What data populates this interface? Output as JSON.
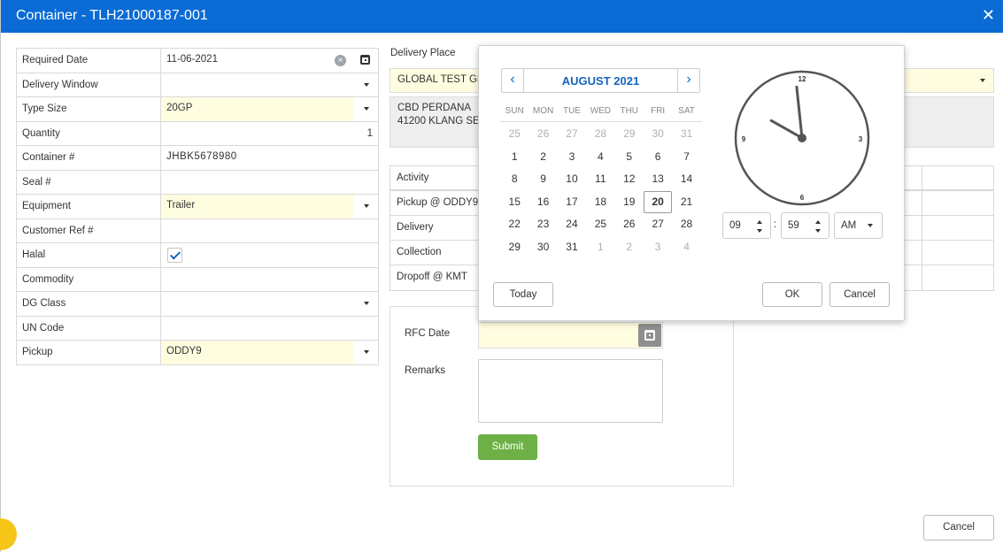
{
  "window": {
    "title": "Container - TLH21000187-001",
    "close_glyph": "✕"
  },
  "form": {
    "rows": [
      {
        "label": "Required Date",
        "value": "11-06-2021"
      },
      {
        "label": "Delivery Window",
        "value": ""
      },
      {
        "label": "Type Size",
        "value": "20GP"
      },
      {
        "label": "Quantity",
        "value": "1"
      },
      {
        "label": "Container #",
        "value": "JHBK5678980"
      },
      {
        "label": "Seal #",
        "value": ""
      },
      {
        "label": "Equipment",
        "value": "Trailer"
      },
      {
        "label": "Customer Ref #",
        "value": ""
      },
      {
        "label": "Halal",
        "checked": true
      },
      {
        "label": "Commodity",
        "value": ""
      },
      {
        "label": "DG Class",
        "value": ""
      },
      {
        "label": "UN Code",
        "value": ""
      },
      {
        "label": "Pickup",
        "value": "ODDY9"
      }
    ]
  },
  "delivery_place": {
    "label": "Delivery Place",
    "value": "GLOBAL TEST GR",
    "address_line1": "CBD PERDANA",
    "address_line2": "41200 KLANG SE"
  },
  "activity": {
    "header": "Activity",
    "rows": [
      "Pickup @ ODDY9",
      "Delivery",
      "Collection",
      "Dropoff @ KMT"
    ]
  },
  "rfc": {
    "date_label": "RFC Date",
    "date_value": "",
    "remarks_label": "Remarks",
    "remarks_value": "",
    "submit_label": "Submit"
  },
  "picker": {
    "month_title": "AUGUST 2021",
    "prev_glyph": "‹",
    "next_glyph": "›",
    "weekdays": [
      "SUN",
      "MON",
      "TUE",
      "WED",
      "THU",
      "FRI",
      "SAT"
    ],
    "days": [
      {
        "d": "25",
        "o": true
      },
      {
        "d": "26",
        "o": true
      },
      {
        "d": "27",
        "o": true
      },
      {
        "d": "28",
        "o": true
      },
      {
        "d": "29",
        "o": true
      },
      {
        "d": "30",
        "o": true
      },
      {
        "d": "31",
        "o": true
      },
      {
        "d": "1"
      },
      {
        "d": "2"
      },
      {
        "d": "3"
      },
      {
        "d": "4"
      },
      {
        "d": "5"
      },
      {
        "d": "6"
      },
      {
        "d": "7"
      },
      {
        "d": "8"
      },
      {
        "d": "9"
      },
      {
        "d": "10"
      },
      {
        "d": "11"
      },
      {
        "d": "12"
      },
      {
        "d": "13"
      },
      {
        "d": "14"
      },
      {
        "d": "15"
      },
      {
        "d": "16"
      },
      {
        "d": "17"
      },
      {
        "d": "18"
      },
      {
        "d": "19"
      },
      {
        "d": "20",
        "s": true
      },
      {
        "d": "21"
      },
      {
        "d": "22"
      },
      {
        "d": "23"
      },
      {
        "d": "24"
      },
      {
        "d": "25"
      },
      {
        "d": "26"
      },
      {
        "d": "27"
      },
      {
        "d": "28"
      },
      {
        "d": "29"
      },
      {
        "d": "30"
      },
      {
        "d": "31"
      },
      {
        "d": "1",
        "o": true
      },
      {
        "d": "2",
        "o": true
      },
      {
        "d": "3",
        "o": true
      },
      {
        "d": "4",
        "o": true
      }
    ],
    "today_label": "Today",
    "ok_label": "OK",
    "cancel_label": "Cancel",
    "clock": {
      "numerals": [
        "12",
        "3",
        "6",
        "9"
      ],
      "hour": 9,
      "minute": 59
    },
    "hour_value": "09",
    "minute_value": "59",
    "separator": ":",
    "ampm_value": "AM"
  },
  "footer": {
    "cancel_label": "Cancel"
  },
  "colors": {
    "accent": "#0a6bd4",
    "required_bg": "#fffde0",
    "submit": "#6db046",
    "link": "#1565c0"
  }
}
